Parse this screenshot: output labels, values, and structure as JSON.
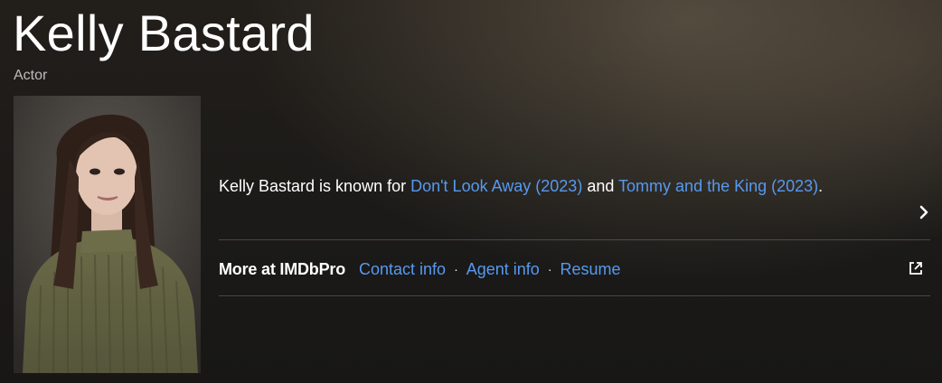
{
  "header": {
    "name": "Kelly Bastard",
    "role": "Actor"
  },
  "photo": {
    "alt": "Kelly Bastard"
  },
  "known_for": {
    "prefix": "Kelly Bastard is known for ",
    "title1": "Don't Look Away (2023)",
    "joiner": " and ",
    "title2": "Tommy and the King (2023)",
    "suffix": ".",
    "icon": "chevron-right-icon"
  },
  "imdbpro": {
    "label": "More at IMDbPro",
    "links": [
      "Contact info",
      "Agent info",
      "Resume"
    ],
    "separator": "·",
    "icon": "external-link-icon"
  },
  "colors": {
    "link": "#5799ef",
    "text": "#ffffff",
    "muted": "#b3b3b3"
  }
}
